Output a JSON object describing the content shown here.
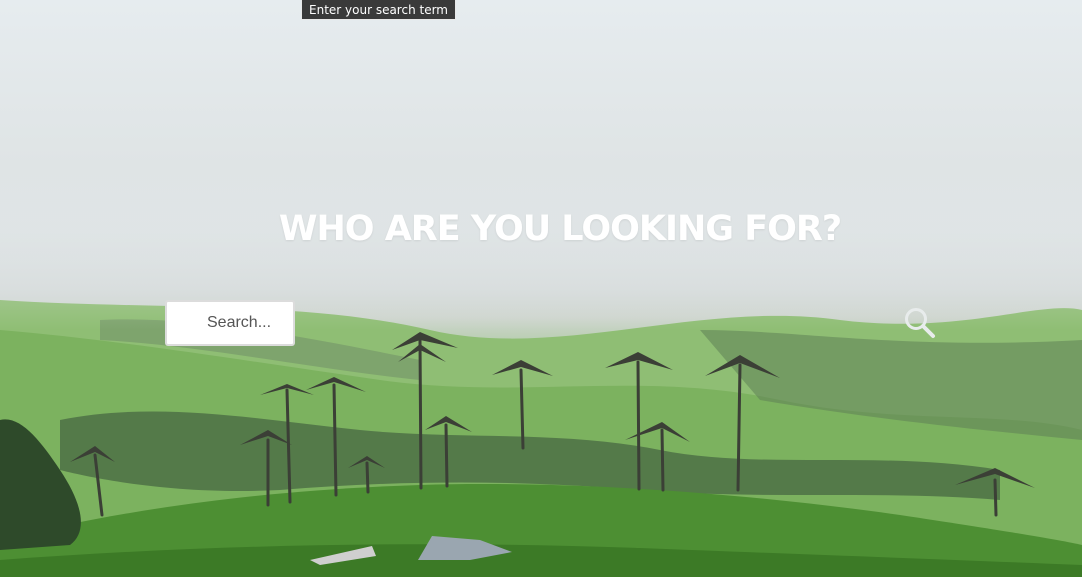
{
  "tooltip": {
    "text": "Enter your search term"
  },
  "hero": {
    "headline": "WHO ARE YOU LOOKING FOR?",
    "background_description_icon": "misty-valley-palm-trees"
  },
  "search": {
    "placeholder": "Search...",
    "value": "",
    "button_icon": "search-icon"
  },
  "colors": {
    "headline": "#ffffff",
    "input_bg": "#ffffff",
    "icon": "#e8ecec"
  }
}
